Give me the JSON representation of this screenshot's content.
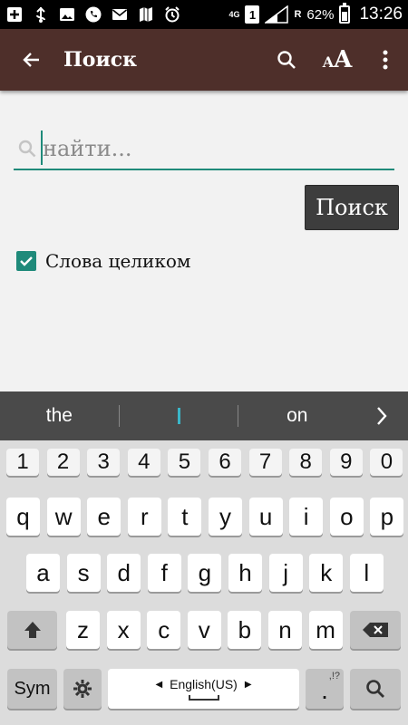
{
  "status": {
    "network": "4G",
    "sim": "1",
    "roaming": "R",
    "battery": "62%",
    "battery_level": 0.62,
    "time": "13:26"
  },
  "appbar": {
    "title": "Поиск",
    "icons": [
      "back-arrow-icon",
      "search-icon",
      "text-size-icon",
      "more-vert-icon"
    ],
    "text_size_small": "A",
    "text_size_big": "A"
  },
  "search": {
    "placeholder": "найти...",
    "value": "",
    "button_label": "Поиск"
  },
  "options": {
    "whole_words_label": "Слова целиком",
    "whole_words_checked": true
  },
  "keyboard": {
    "suggestions": [
      "the",
      "",
      "on"
    ],
    "numbers": [
      "1",
      "2",
      "3",
      "4",
      "5",
      "6",
      "7",
      "8",
      "9",
      "0"
    ],
    "row1": [
      "q",
      "w",
      "e",
      "r",
      "t",
      "y",
      "u",
      "i",
      "o",
      "p"
    ],
    "row2": [
      "a",
      "s",
      "d",
      "f",
      "g",
      "h",
      "j",
      "k",
      "l"
    ],
    "row3": [
      "z",
      "x",
      "c",
      "v",
      "b",
      "n",
      "m"
    ],
    "sym_label": "Sym",
    "language_label": "English(US)",
    "period_label": ".",
    "period_hint": ",!?"
  },
  "colors": {
    "appbar": "#4e2f2a",
    "accent": "#1f8a7a",
    "button": "#3d3d3d",
    "suggest_bar": "#4a4a4a"
  }
}
